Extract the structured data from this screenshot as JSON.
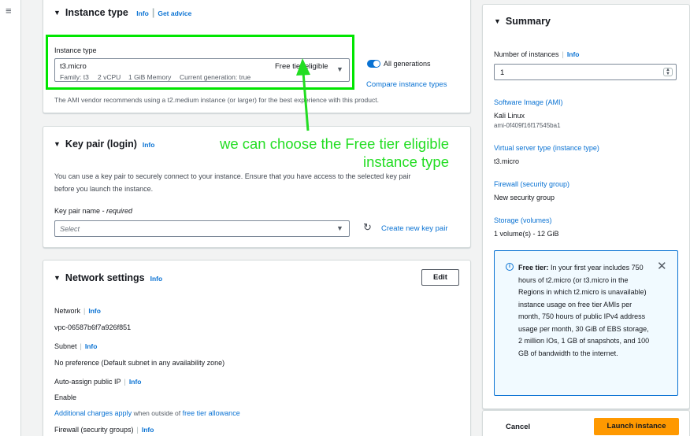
{
  "nav": {
    "menu_icon": "hamburger-menu-icon"
  },
  "instance_type": {
    "title": "Instance type",
    "info": "Info",
    "get_advice": "Get advice",
    "field_label": "Instance type",
    "selected": "t3.micro",
    "free_tier": "Free tier eligible",
    "family": "Family: t3",
    "vcpu": "2 vCPU",
    "memory": "1 GiB Memory",
    "generation": "Current generation: true",
    "all_generations": "All generations",
    "compare": "Compare instance types",
    "note": "The AMI vendor recommends using a t2.medium instance (or larger) for the best experience with this product."
  },
  "annotation": {
    "line1": "we can choose the Free tier eligible",
    "line2": "instance type",
    "color": "#22dd22"
  },
  "key_pair": {
    "title": "Key pair (login)",
    "info": "Info",
    "desc1": "You can use a key pair to securely connect to your instance. Ensure that you have access to the selected key pair",
    "desc2": "before you launch the instance.",
    "name_label": "Key pair name",
    "required": "- required",
    "placeholder": "Select",
    "create": "Create new key pair"
  },
  "network": {
    "title": "Network settings",
    "info": "Info",
    "edit": "Edit",
    "network_label": "Network",
    "network_value": "vpc-06587b6f7a926f851",
    "subnet_label": "Subnet",
    "subnet_value": "No preference (Default subnet in any availability zone)",
    "public_ip_label": "Auto-assign public IP",
    "public_ip_value": "Enable",
    "charges_link": "Additional charges apply",
    "charges_mid": "when outside of",
    "free_tier_link": "free tier allowance",
    "firewall_label": "Firewall (security groups)"
  },
  "summary": {
    "title": "Summary",
    "num_label": "Number of instances",
    "info": "Info",
    "num_value": "1",
    "software_label": "Software Image (AMI)",
    "software_value": "Kali Linux",
    "software_id": "ami-0f409f16f17545ba1",
    "vst_label": "Virtual server type (instance type)",
    "vst_value": "t3.micro",
    "firewall_label": "Firewall (security group)",
    "firewall_value": "New security group",
    "storage_label": "Storage (volumes)",
    "storage_value": "1 volume(s) - 12 GiB",
    "free_tier_title": "Free tier:",
    "free_tier_text": "In your first year includes 750 hours of t2.micro (or t3.micro in the Regions in which t2.micro is unavailable) instance usage on free tier AMIs per month, 750 hours of public IPv4 address usage per month, 30 GiB of EBS storage, 2 million IOs, 1 GB of snapshots, and 100 GB of bandwidth to the internet.",
    "cancel": "Cancel",
    "launch": "Launch instance"
  }
}
